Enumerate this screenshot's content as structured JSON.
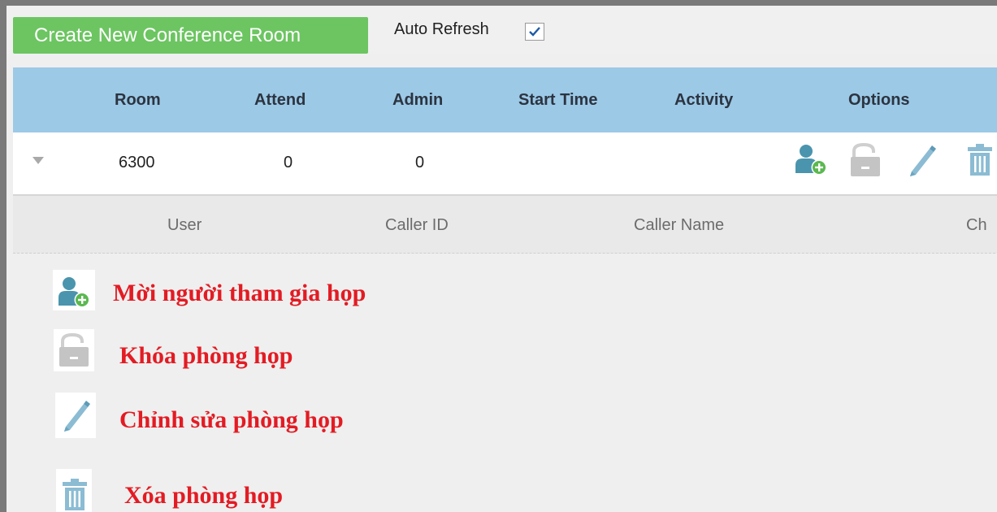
{
  "toolbar": {
    "create_button_label": "Create New Conference Room",
    "auto_refresh_label": "Auto Refresh",
    "auto_refresh_checked": true
  },
  "table": {
    "columns": [
      "Room",
      "Attend",
      "Admin",
      "Start Time",
      "Activity",
      "Options"
    ],
    "rows": [
      {
        "room": "6300",
        "attend": "0",
        "admin": "0",
        "start_time": "",
        "activity": "",
        "options": [
          "add-user-icon",
          "unlock-icon",
          "edit-icon",
          "delete-icon"
        ]
      }
    ],
    "sub_columns": [
      "User",
      "Caller ID",
      "Caller Name",
      "Ch"
    ]
  },
  "legend": {
    "invite": "Mời người tham gia họp",
    "lock": "Khóa phòng họp",
    "edit": "Chỉnh sửa phòng họp",
    "delete": "Xóa phòng họp"
  },
  "colors": {
    "accent_green": "#6cc561",
    "header_blue": "#9cc9e6",
    "legend_red": "#e31b23",
    "icon_teal": "#4a95ad"
  }
}
